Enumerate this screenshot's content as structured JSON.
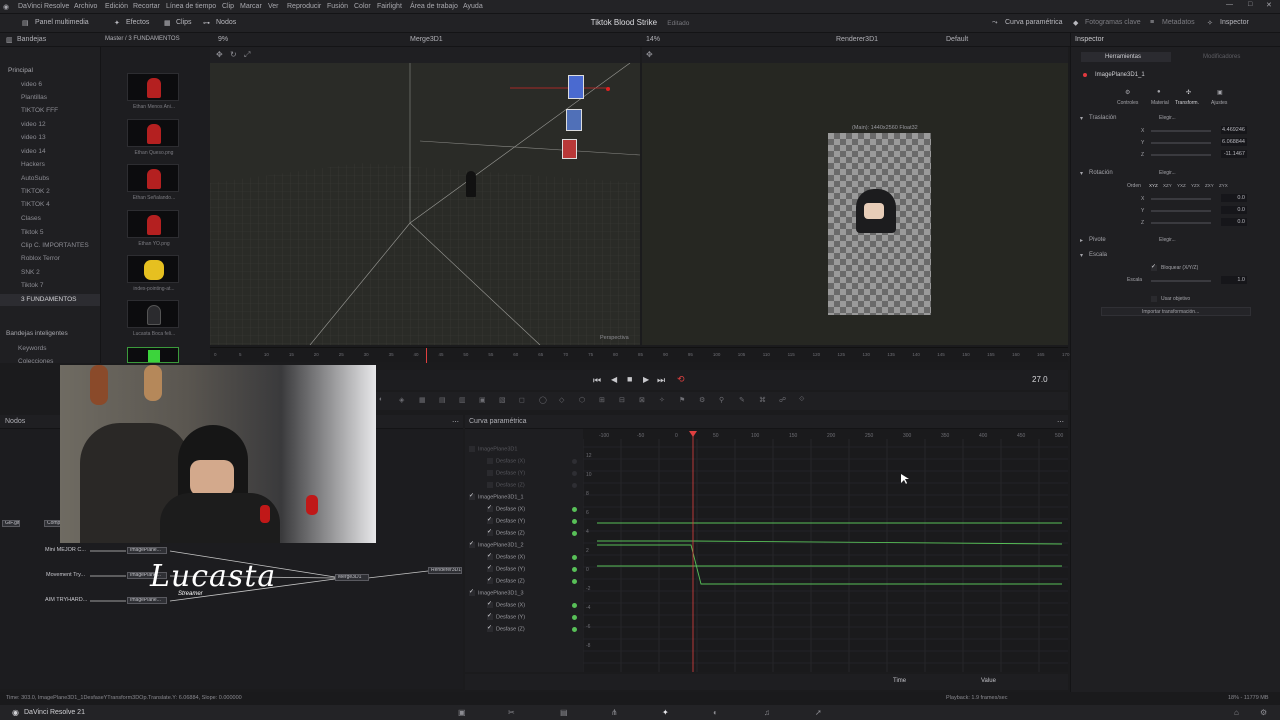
{
  "menu": {
    "items": [
      "DaVinci Resolve",
      "Archivo",
      "Edición",
      "Recortar",
      "Línea de tiempo",
      "Clip",
      "Marcar",
      "Ver",
      "Reproducir",
      "Fusión",
      "Color",
      "Fairlight",
      "Área de trabajo",
      "Ayuda"
    ]
  },
  "toolbar": {
    "media_pool": "Panel multimedia",
    "effects": "Efectos",
    "clips": "Clips",
    "nodes": "Nodos",
    "project_title": "Tiktok Blood Strike",
    "project_status": "Editado",
    "curves": "Curva paramétrica",
    "keyframes": "Fotogramas clave",
    "metadata": "Metadatos",
    "inspector": "Inspector"
  },
  "panels": {
    "bins": "Bandejas",
    "media_path": "Master / 3 FUNDAMENTOS",
    "zoom_left": "9%",
    "viewer1_title": "Merge3D1",
    "zoom_right": "14%",
    "viewer2_title": "Renderer3D1",
    "layout": "Default",
    "inspector_title": "Inspector"
  },
  "bins": {
    "root": "Principal",
    "items": [
      "video 6",
      "Plantillas",
      "TIKTOK FFF",
      "video 12",
      "video 13",
      "video 14",
      "Hackers",
      "AutoSubs",
      "TIKTOK 2",
      "TIKTOK 4",
      "Clases",
      "Tiktok 5",
      "Clip C. IMPORTANTES",
      "Roblox Terror",
      "SNK 2",
      "Tiktok 7",
      "3 FUNDAMENTOS"
    ],
    "smart": "Bandejas inteligentes",
    "smart_items": [
      "Keywords",
      "Colecciones"
    ]
  },
  "media_items": [
    "Ethan Menos Ani...",
    "Ethan Queso.png",
    "Ethan Señalando...",
    "Ethan YO.png",
    "index-pointing-at...",
    "Lucasta Boca feli..."
  ],
  "viewer": {
    "perspective": "Perspectiva",
    "render_info": "(Main): 1440x2560 Float32"
  },
  "ruler": {
    "ticks": [
      "0",
      "5",
      "10",
      "15",
      "20",
      "25",
      "30",
      "35",
      "40",
      "45",
      "50",
      "55",
      "60",
      "65",
      "70",
      "75",
      "80",
      "85",
      "90",
      "95",
      "100",
      "105",
      "110",
      "115",
      "120",
      "125",
      "130",
      "135",
      "140",
      "145",
      "150",
      "155",
      "160",
      "165",
      "170"
    ]
  },
  "transport": {
    "frame": "27.0"
  },
  "nodes_panel": {
    "title": "Nodos",
    "nodes": [
      "GIF.gif",
      "Comp",
      "Mini MEJOR C...",
      "ImagePlane...",
      "Movement Try...",
      "ImagePlane...",
      "AIM TRYHARD...",
      "ImagePlane...",
      "Merge3D1",
      "Renderer3D1"
    ]
  },
  "watermark": {
    "name": "Lucasta",
    "sub": "Streamer"
  },
  "spline": {
    "title": "Curva paramétrica",
    "tree": [
      {
        "name": "ImagePlane3D1",
        "muted": true,
        "children": [
          "Desfase (X)",
          "Desfase (Y)",
          "Desfase (Z)"
        ]
      },
      {
        "name": "ImagePlane3D1_1",
        "muted": false,
        "children": [
          "Desfase (X)",
          "Desfase (Y)",
          "Desfase (Z)"
        ]
      },
      {
        "name": "ImagePlane3D1_2",
        "muted": false,
        "children": [
          "Desfase (X)",
          "Desfase (Y)",
          "Desfase (Z)"
        ]
      },
      {
        "name": "ImagePlane3D1_3",
        "muted": false,
        "children": [
          "Desfase (X)",
          "Desfase (Y)",
          "Desfase (Z)"
        ]
      }
    ],
    "x_ticks": [
      "-100",
      "-50",
      "0",
      "50",
      "100",
      "150",
      "200",
      "250",
      "300",
      "350",
      "400",
      "450",
      "500"
    ],
    "y_ticks": [
      "12",
      "10",
      "8",
      "6",
      "4",
      "2",
      "0",
      "-2",
      "-4",
      "-6",
      "-8"
    ],
    "time_label": "Time",
    "value_label": "Value"
  },
  "inspector": {
    "tab_tools": "Herramientas",
    "tab_modifiers": "Modificadores",
    "node_name": "ImagePlane3D1_1",
    "subtabs": [
      "Controles",
      "Material",
      "Transform.",
      "Ajustes"
    ],
    "translation": "Traslación",
    "pick": "Elegir...",
    "tx": "4.469246",
    "ty": "6.068844",
    "tz": "-11.1467",
    "rotation": "Rotación",
    "order_label": "Orden",
    "orders": [
      "XYZ",
      "XZY",
      "YXZ",
      "YZX",
      "ZXY",
      "ZYX"
    ],
    "rx": "0.0",
    "ry": "0.0",
    "rz": "0.0",
    "pivot": "Pivote",
    "scale": "Escala",
    "lock_label": "Bloquear (X/Y/Z)",
    "scale_label": "Escala",
    "scale_value": "1.0",
    "target_label": "Usar objetivo",
    "import_btn": "Importar transformación..."
  },
  "status": {
    "left": "Time: 303.0,   ImagePlane3D1_1DesfaseYTransform3DOp.Translate.Y:   6.06884,  Slope: 0.000000",
    "playback": "Playback: 1.9 frames/sec",
    "memory": "18% - 11779 MB"
  },
  "footer": {
    "app": "DaVinci Resolve 21"
  },
  "colors": {
    "accent": "#e0393f",
    "curve": "#58c058",
    "playhead": "#e04040"
  }
}
